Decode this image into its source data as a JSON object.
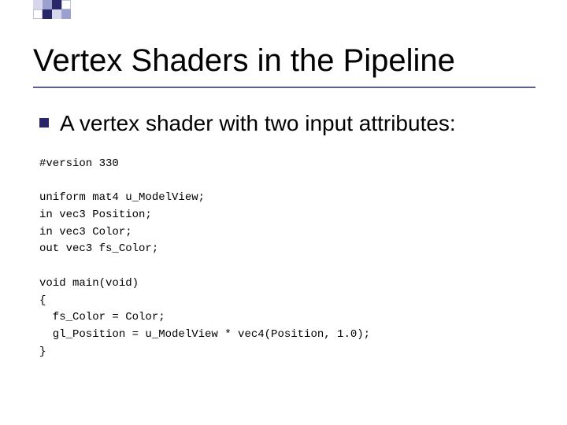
{
  "slide": {
    "title": "Vertex Shaders in the Pipeline",
    "bullet": "A vertex shader with two input attributes:",
    "code": {
      "l1": "#version 330",
      "l2": "",
      "l3": "uniform mat4 u_ModelView;",
      "l4": "in vec3 Position;",
      "l5": "in vec3 Color;",
      "l6": "out vec3 fs_Color;",
      "l7": "",
      "l8": "void main(void)",
      "l9": "{",
      "l10": "  fs_Color = Color;",
      "l11": "  gl_Position = u_ModelView * vec4(Position, 1.0);",
      "l12": "}"
    }
  },
  "decor": {
    "colors": {
      "dark": "#2a2769",
      "mid": "#9ba0cf",
      "light": "#d6d7ea",
      "border": "#7d82b3"
    }
  }
}
